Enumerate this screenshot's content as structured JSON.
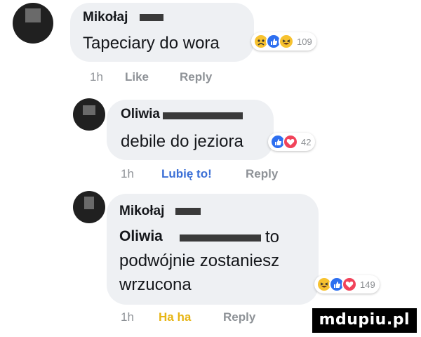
{
  "comments": [
    {
      "author": "Mikołaj",
      "lines": [
        "Tapeciary do wora"
      ],
      "reaction_count": "109",
      "reactions": [
        "sad-icon",
        "like-icon",
        "haha-icon"
      ],
      "time": "1h",
      "action_react": "Like",
      "action_reply": "Reply"
    },
    {
      "author": "Oliwia",
      "lines": [
        "debile do jeziora"
      ],
      "reaction_count": "42",
      "reactions": [
        "like-icon",
        "love-icon"
      ],
      "time": "1h",
      "action_react": "Lubię to!",
      "action_reply": "Reply"
    },
    {
      "author": "Mikołaj",
      "mention": "Oliwia",
      "lines": [
        "to",
        "podwójnie zostaniesz",
        "wrzucona"
      ],
      "reaction_count": "149",
      "reactions": [
        "haha-icon",
        "like-icon",
        "love-icon"
      ],
      "time": "1h",
      "action_react": "Ha ha",
      "action_reply": "Reply"
    }
  ],
  "watermark": "mdupiu.pl",
  "colors": {
    "bubble": "#eef0f3",
    "link_blue": "#3b6fd6",
    "haha_yellow": "#e7b514",
    "meta_gray": "#8e9297"
  }
}
